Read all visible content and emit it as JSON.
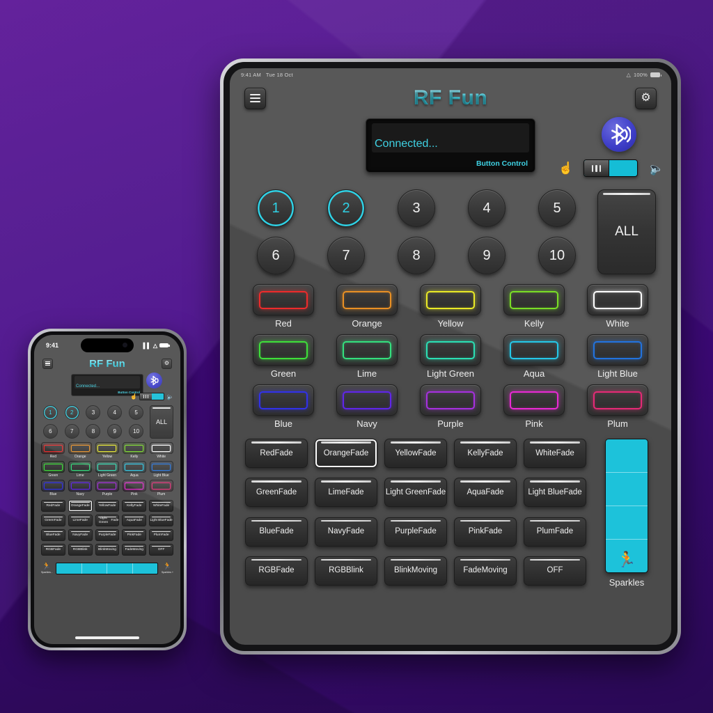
{
  "app": {
    "title": "RF Fun",
    "accent": "#2fd2e6",
    "bluetooth_color": "#3a3ac2",
    "background": "#4b1492"
  },
  "tablet": {
    "status_bar": {
      "time": "9:41 AM",
      "date": "Tue 18 Oct",
      "wifi_icon": "wifi-icon",
      "battery_percent": "100%",
      "battery_icon": "battery-full-icon"
    },
    "header": {
      "menu_icon": "hamburger-menu-icon",
      "title": "RF Fun",
      "settings_icon": "gear-icon"
    },
    "status_panel": {
      "connection_text": "Connected...",
      "mode_text": "Button Control"
    },
    "bluetooth": {
      "icon": "bluetooth-icon"
    },
    "mode_toggle": {
      "left_icon": "touch-hand-icon",
      "right_icon": "microphone-icon",
      "state": "on",
      "knob_icon": "grip-handle-icon"
    },
    "channels": {
      "buttons": [
        {
          "label": "1",
          "active": true
        },
        {
          "label": "2",
          "active": true
        },
        {
          "label": "3",
          "active": false
        },
        {
          "label": "4",
          "active": false
        },
        {
          "label": "5",
          "active": false
        },
        {
          "label": "6",
          "active": false
        },
        {
          "label": "7",
          "active": false
        },
        {
          "label": "8",
          "active": false
        },
        {
          "label": "9",
          "active": false
        },
        {
          "label": "10",
          "active": false
        }
      ],
      "all_label": "ALL"
    },
    "colors": [
      {
        "label": "Red",
        "hex": "#ee2b2b"
      },
      {
        "label": "Orange",
        "hex": "#e99024"
      },
      {
        "label": "Yellow",
        "hex": "#eaea26"
      },
      {
        "label": "Kelly",
        "hex": "#7ade26"
      },
      {
        "label": "White",
        "hex": "#ffffff"
      },
      {
        "label": "Green",
        "hex": "#3ee03a"
      },
      {
        "label": "Lime",
        "hex": "#34e07e"
      },
      {
        "label": "Light Green",
        "hex": "#2be0b4"
      },
      {
        "label": "Aqua",
        "hex": "#25c8e8"
      },
      {
        "label": "Light Blue",
        "hex": "#2273df"
      },
      {
        "label": "Blue",
        "hex": "#3131e8"
      },
      {
        "label": "Navy",
        "hex": "#6026ea"
      },
      {
        "label": "Purple",
        "hex": "#a730e0"
      },
      {
        "label": "Pink",
        "hex": "#ea2ad4"
      },
      {
        "label": "Plum",
        "hex": "#e62a76"
      }
    ],
    "effects": [
      {
        "label": "Red\nFade",
        "selected": false
      },
      {
        "label": "Orange\nFade",
        "selected": true
      },
      {
        "label": "Yellow\nFade",
        "selected": false
      },
      {
        "label": "Kelly\nFade",
        "selected": false
      },
      {
        "label": "White\nFade",
        "selected": false
      },
      {
        "label": "Green\nFade",
        "selected": false
      },
      {
        "label": "Lime\nFade",
        "selected": false
      },
      {
        "label": "Light Green\nFade",
        "selected": false
      },
      {
        "label": "Aqua\nFade",
        "selected": false
      },
      {
        "label": "Light Blue\nFade",
        "selected": false
      },
      {
        "label": "Blue\nFade",
        "selected": false
      },
      {
        "label": "Navy\nFade",
        "selected": false
      },
      {
        "label": "Purple\nFade",
        "selected": false
      },
      {
        "label": "Pink\nFade",
        "selected": false
      },
      {
        "label": "Plum\nFade",
        "selected": false
      },
      {
        "label": "RGB\nFade",
        "selected": false
      },
      {
        "label": "RGB\nBlink",
        "selected": false
      },
      {
        "label": "Blink\nMoving",
        "selected": false
      },
      {
        "label": "Fade\nMoving",
        "selected": false
      },
      {
        "label": "OFF",
        "selected": false
      }
    ],
    "sparkles": {
      "label": "Sparkles",
      "segments": 4,
      "fill_color": "#1dc2da",
      "runner_icon": "running-person-icon"
    }
  },
  "phone": {
    "status_bar": {
      "time": "9:41",
      "signal_icon": "cellular-signal-icon",
      "wifi_icon": "wifi-icon",
      "battery_icon": "battery-full-icon"
    },
    "header": {
      "menu_icon": "hamburger-menu-icon",
      "title": "RF Fun",
      "settings_icon": "gear-icon"
    },
    "status_panel": {
      "connection_text": "Connected...",
      "mode_text": "Button Control"
    },
    "sparkles": {
      "minus_label": "Sparkles -",
      "plus_label": "Sparkles +",
      "segments": 4
    }
  }
}
